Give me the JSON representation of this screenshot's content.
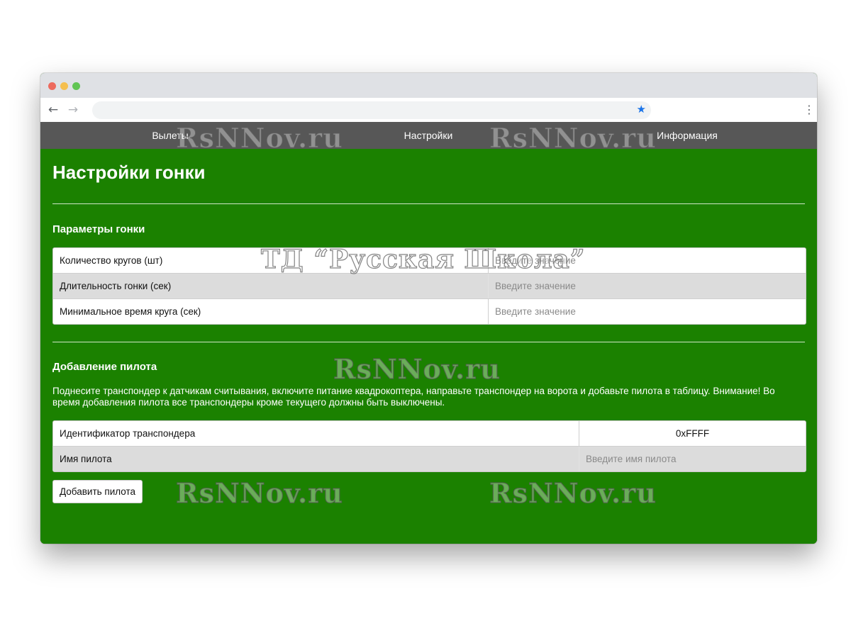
{
  "browser": {
    "back_icon": "←",
    "forward_icon": "→",
    "star_icon": "★",
    "menu_icon": "⋮"
  },
  "nav": {
    "items": [
      {
        "label": "Вылеты"
      },
      {
        "label": "Настройки"
      },
      {
        "label": "Информация"
      }
    ]
  },
  "page": {
    "title": "Настройки гонки"
  },
  "race_params": {
    "title": "Параметры гонки",
    "rows": [
      {
        "label": "Количество кругов (шт)",
        "placeholder": "Введите значение",
        "value": ""
      },
      {
        "label": "Длительность гонки (сек)",
        "placeholder": "Введите значение",
        "value": ""
      },
      {
        "label": "Минимальное время круга (сек)",
        "placeholder": "Введите значение",
        "value": ""
      }
    ]
  },
  "add_pilot": {
    "title": "Добавление пилота",
    "description": "Поднесите транспондер к датчикам считывания, включите питание квадрокоптера, направьте транспондер на ворота и добавьте пилота в таблицу. Внимание! Во время добавления пилота все транспондеры кроме текущего должны быть выключены.",
    "transponder_label": "Идентификатор транспондера",
    "transponder_value": "0xFFFF",
    "pilot_name_label": "Имя пилота",
    "pilot_name_placeholder": "Введите имя пилота",
    "button_label": "Добавить пилота"
  },
  "watermarks": {
    "site": "RsNNov.ru",
    "shop": "ТД “Русская Школа”"
  },
  "colors": {
    "page_background": "#1b8100",
    "nav_background": "#575757"
  }
}
